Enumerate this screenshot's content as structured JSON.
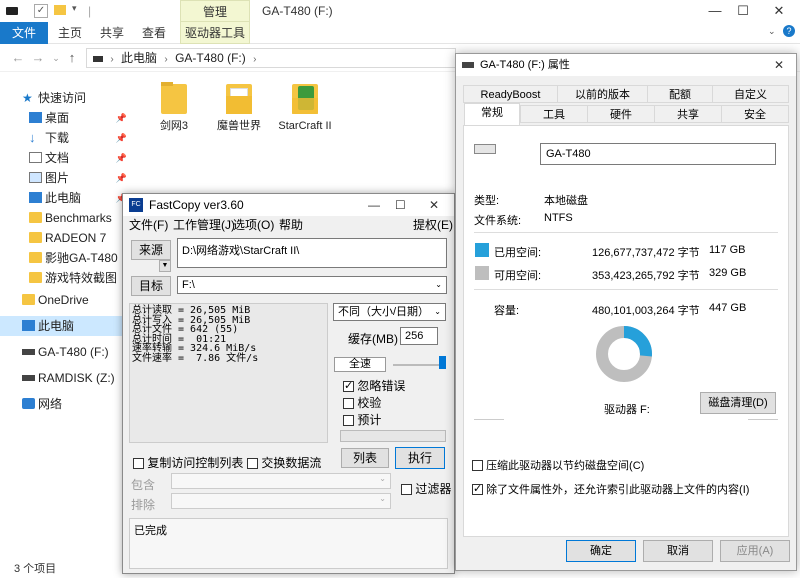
{
  "explorer": {
    "title": "GA-T480 (F:)",
    "ribbon_context_tab": "管理",
    "menu": {
      "file": "文件",
      "home": "主页",
      "share": "共享",
      "view": "查看",
      "drive_tools": "驱动器工具"
    },
    "breadcrumb": [
      "此电脑",
      "GA-T480 (F:)"
    ],
    "sidebar": {
      "quick_access": "快速访问",
      "items": [
        {
          "label": "桌面",
          "icon": "desktop-icon"
        },
        {
          "label": "下载",
          "icon": "download-icon"
        },
        {
          "label": "文档",
          "icon": "document-icon"
        },
        {
          "label": "图片",
          "icon": "picture-icon"
        },
        {
          "label": "此电脑",
          "icon": "computer-icon"
        },
        {
          "label": "Benchmarks",
          "icon": "folder-icon"
        },
        {
          "label": "RADEON 7",
          "icon": "folder-icon"
        },
        {
          "label": "影驰GA-T480",
          "icon": "folder-icon"
        },
        {
          "label": "游戏特效截图",
          "icon": "folder-icon"
        }
      ],
      "onedrive": "OneDrive",
      "this_pc": "此电脑",
      "drive_f": "GA-T480 (F:)",
      "ramdisk": "RAMDISK (Z:)",
      "network": "网络"
    },
    "files": [
      {
        "name": "剑网3"
      },
      {
        "name": "魔兽世界"
      },
      {
        "name": "StarCraft II"
      }
    ],
    "status": "3 个项目"
  },
  "fastcopy": {
    "title": "FastCopy ver3.60",
    "menu": {
      "file": "文件(F)",
      "job": "工作管理(J)",
      "option": "选项(O)",
      "help": "帮助",
      "extra": "提权(E)"
    },
    "source_label": "来源",
    "source_value": "D:\\网络游戏\\StarCraft II\\",
    "dest_label": "目标",
    "dest_value": "F:\\",
    "log": "总计读取 = 26,505 MiB\n总计写入 = 26,505 MiB\n总计文件 = 642 (55)\n总计时间 =  01:21\n速率转输 = 324.6 MiB/s\n文件速率 =  7.86 文件/s",
    "mode": "不同（大小/日期）",
    "buffer_label": "缓存(MB)",
    "buffer_value": "256",
    "speed_label": "全速",
    "ignore_errors": "忽略错误",
    "verify": "校验",
    "estimate": "预计",
    "copy_acl": "复制访问控制列表",
    "alt_stream": "交换数据流",
    "list_button": "列表",
    "execute_button": "执行",
    "include_label": "包含",
    "exclude_label": "排除",
    "filter_label": "过滤器",
    "status": "已完成"
  },
  "props": {
    "title": "GA-T480 (F:) 属性",
    "tabs_row1": [
      "ReadyBoost",
      "以前的版本",
      "配额",
      "自定义"
    ],
    "tabs_row2": [
      "常规",
      "工具",
      "硬件",
      "共享",
      "安全"
    ],
    "drive_name": "GA-T480",
    "type_label": "类型:",
    "type_value": "本地磁盘",
    "fs_label": "文件系统:",
    "fs_value": "NTFS",
    "used_label": "已用空间:",
    "used_bytes": "126,677,737,472 字节",
    "used_gb": "117 GB",
    "free_label": "可用空间:",
    "free_bytes": "353,423,265,792 字节",
    "free_gb": "329 GB",
    "capacity_label": "容量:",
    "capacity_bytes": "480,101,003,264 字节",
    "capacity_gb": "447 GB",
    "drive_label": "驱动器 F:",
    "cleanup_button": "磁盘清理(D)",
    "compress_label": "压缩此驱动器以节约磁盘空间(C)",
    "index_label": "除了文件属性外，还允许索引此驱动器上文件的内容(I)",
    "ok_button": "确定",
    "cancel_button": "取消",
    "apply_button": "应用(A)",
    "used_fraction": 0.264,
    "colors": {
      "used": "#26a0da",
      "free": "#bebebe"
    }
  }
}
